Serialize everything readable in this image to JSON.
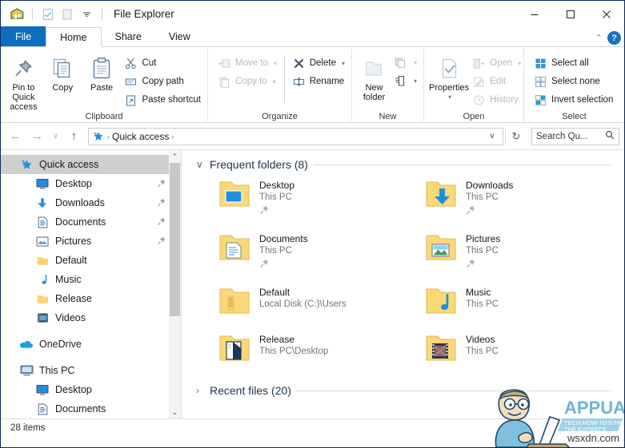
{
  "window": {
    "title": "File Explorer",
    "quick_access_toolbar": [
      {
        "name": "explorer-icon",
        "label": "File Explorer"
      },
      {
        "name": "properties-qat-icon",
        "label": "Properties"
      },
      {
        "name": "new-folder-qat-icon",
        "label": "New folder"
      },
      {
        "name": "customize-qat-icon",
        "label": "Customize Quick Access Toolbar"
      }
    ],
    "controls": {
      "minimize": "–",
      "maximize": "☐",
      "close": "✕"
    }
  },
  "tabs": [
    {
      "label": "File",
      "kind": "file"
    },
    {
      "label": "Home",
      "kind": "active"
    },
    {
      "label": "Share",
      "kind": "normal"
    },
    {
      "label": "View",
      "kind": "normal"
    }
  ],
  "ribbon": {
    "collapse_chevron": "⌃",
    "help_label": "?",
    "groups": [
      {
        "label": "Clipboard",
        "big_buttons": [
          {
            "name": "pin-to-quick-access-button",
            "label": "Pin to Quick\naccess",
            "line1": "Pin to Quick",
            "line2": "access",
            "icon": "pin-icon",
            "disabled": false
          },
          {
            "name": "copy-button",
            "label": "Copy",
            "line1": "Copy",
            "line2": "",
            "icon": "copy-icon",
            "disabled": false
          },
          {
            "name": "paste-button",
            "label": "Paste",
            "line1": "Paste",
            "line2": "",
            "icon": "paste-icon",
            "disabled": false
          }
        ],
        "small_buttons": [
          {
            "name": "cut-button",
            "label": "Cut",
            "icon": "scissors-icon",
            "disabled": false,
            "caret": false
          },
          {
            "name": "copy-path-button",
            "label": "Copy path",
            "icon": "copy-path-icon",
            "disabled": false,
            "caret": false
          },
          {
            "name": "paste-shortcut-button",
            "label": "Paste shortcut",
            "icon": "paste-shortcut-icon",
            "disabled": false,
            "caret": false
          }
        ]
      },
      {
        "label": "Organize",
        "small_buttons_a": [
          {
            "name": "move-to-button",
            "label": "Move to",
            "icon": "move-to-icon",
            "disabled": true,
            "caret": true
          },
          {
            "name": "copy-to-button",
            "label": "Copy to",
            "icon": "copy-to-icon",
            "disabled": true,
            "caret": true
          }
        ],
        "small_buttons_b": [
          {
            "name": "delete-button",
            "label": "Delete",
            "icon": "delete-x-icon",
            "disabled": false,
            "caret": true
          },
          {
            "name": "rename-button",
            "label": "Rename",
            "icon": "rename-icon",
            "disabled": false,
            "caret": false
          }
        ]
      },
      {
        "label": "New",
        "big_buttons": [
          {
            "name": "new-folder-button",
            "line1": "New",
            "line2": "folder",
            "icon": "new-folder-icon",
            "disabled": false
          }
        ],
        "stack_buttons": [
          {
            "name": "new-item-button",
            "icon": "new-item-icon",
            "caret": true,
            "disabled": true
          },
          {
            "name": "easy-access-button",
            "icon": "easy-access-icon",
            "caret": true,
            "disabled": false
          }
        ]
      },
      {
        "label": "Open",
        "big_buttons": [
          {
            "name": "properties-button",
            "line1": "Properties",
            "line2": "",
            "icon": "properties-icon",
            "disabled": false,
            "caret": true
          }
        ],
        "small_buttons": [
          {
            "name": "open-button",
            "label": "Open",
            "icon": "open-icon",
            "disabled": true,
            "caret": true
          },
          {
            "name": "edit-button",
            "label": "Edit",
            "icon": "edit-icon",
            "disabled": true,
            "caret": false
          },
          {
            "name": "history-button",
            "label": "History",
            "icon": "history-icon",
            "disabled": true,
            "caret": false
          }
        ]
      },
      {
        "label": "Select",
        "small_buttons": [
          {
            "name": "select-all-button",
            "label": "Select all",
            "icon": "select-all-icon",
            "disabled": false,
            "caret": false
          },
          {
            "name": "select-none-button",
            "label": "Select none",
            "icon": "select-none-icon",
            "disabled": false,
            "caret": false
          },
          {
            "name": "invert-selection-button",
            "label": "Invert selection",
            "icon": "invert-selection-icon",
            "disabled": false,
            "caret": false
          }
        ]
      }
    ]
  },
  "address": {
    "back_glyph": "←",
    "forward_glyph": "→",
    "recent_glyph": "∨",
    "up_glyph": "↑",
    "crumb_icon": "quick-access-star-icon",
    "crumbs": [
      "Quick access"
    ],
    "crumb_sep": "›",
    "dropdown_glyph": "∨",
    "refresh_glyph": "↻",
    "search_placeholder": "Search Qu...",
    "search_value": "",
    "search_icon": "search-icon"
  },
  "navigation_pane": {
    "items": [
      {
        "label": "Quick access",
        "icon": "quick-access-star-icon",
        "selected": true,
        "pinned": false,
        "indent": 0
      },
      {
        "label": "Desktop",
        "icon": "desktop-icon",
        "selected": false,
        "pinned": true,
        "indent": 1
      },
      {
        "label": "Downloads",
        "icon": "downloads-icon",
        "selected": false,
        "pinned": true,
        "indent": 1
      },
      {
        "label": "Documents",
        "icon": "documents-icon",
        "selected": false,
        "pinned": true,
        "indent": 1
      },
      {
        "label": "Pictures",
        "icon": "pictures-icon",
        "selected": false,
        "pinned": true,
        "indent": 1
      },
      {
        "label": "Default",
        "icon": "folder-icon",
        "selected": false,
        "pinned": false,
        "indent": 1
      },
      {
        "label": "Music",
        "icon": "music-icon",
        "selected": false,
        "pinned": false,
        "indent": 1
      },
      {
        "label": "Release",
        "icon": "folder-icon",
        "selected": false,
        "pinned": false,
        "indent": 1
      },
      {
        "label": "Videos",
        "icon": "videos-icon",
        "selected": false,
        "pinned": false,
        "indent": 1
      },
      {
        "label": "OneDrive",
        "icon": "onedrive-cloud-icon",
        "selected": false,
        "pinned": false,
        "indent": 0,
        "gap_before": true
      },
      {
        "label": "This PC",
        "icon": "this-pc-icon",
        "selected": false,
        "pinned": false,
        "indent": 0,
        "gap_before": true
      },
      {
        "label": "Desktop",
        "icon": "desktop-icon",
        "selected": false,
        "pinned": false,
        "indent": 1
      },
      {
        "label": "Documents",
        "icon": "documents-icon",
        "selected": false,
        "pinned": false,
        "indent": 1
      }
    ],
    "scroll_up_glyph": "⌃",
    "scroll_down_glyph": "⌄"
  },
  "content": {
    "sections": [
      {
        "name": "frequent-folders",
        "title": "Frequent folders (8)",
        "expanded": true,
        "chevron": "∨"
      },
      {
        "name": "recent-files",
        "title": "Recent files (20)",
        "expanded": false,
        "chevron": "›"
      }
    ],
    "frequent_folders": [
      {
        "name": "Desktop",
        "path": "This PC",
        "icon": "folder-desktop-icon",
        "pinned": true
      },
      {
        "name": "Downloads",
        "path": "This PC",
        "icon": "folder-downloads-icon",
        "pinned": true
      },
      {
        "name": "Documents",
        "path": "This PC",
        "icon": "folder-documents-icon",
        "pinned": true
      },
      {
        "name": "Pictures",
        "path": "This PC",
        "icon": "folder-pictures-icon",
        "pinned": true
      },
      {
        "name": "Default",
        "path": "Local Disk (C:)\\Users",
        "icon": "folder-default-icon",
        "pinned": false
      },
      {
        "name": "Music",
        "path": "This PC",
        "icon": "folder-music-icon",
        "pinned": false
      },
      {
        "name": "Release",
        "path": "This PC\\Desktop",
        "icon": "folder-release-icon",
        "pinned": false
      },
      {
        "name": "Videos",
        "path": "This PC",
        "icon": "folder-videos-icon",
        "pinned": false
      }
    ]
  },
  "status_bar": {
    "item_count": "28 items"
  },
  "watermark": {
    "brand": "APPUALS",
    "tagline": "TECH HOW-TO'S FROM THE EXPERTS",
    "url": "wsxdn.com"
  },
  "colors": {
    "file_tab_blue": "#0d6ebf",
    "accent_blue": "#1571c4",
    "selection_gray": "#cfcfcf",
    "folder_yellow": "#ffd878",
    "section_heading": "#20354a",
    "window_border": "#0a2a5e"
  }
}
